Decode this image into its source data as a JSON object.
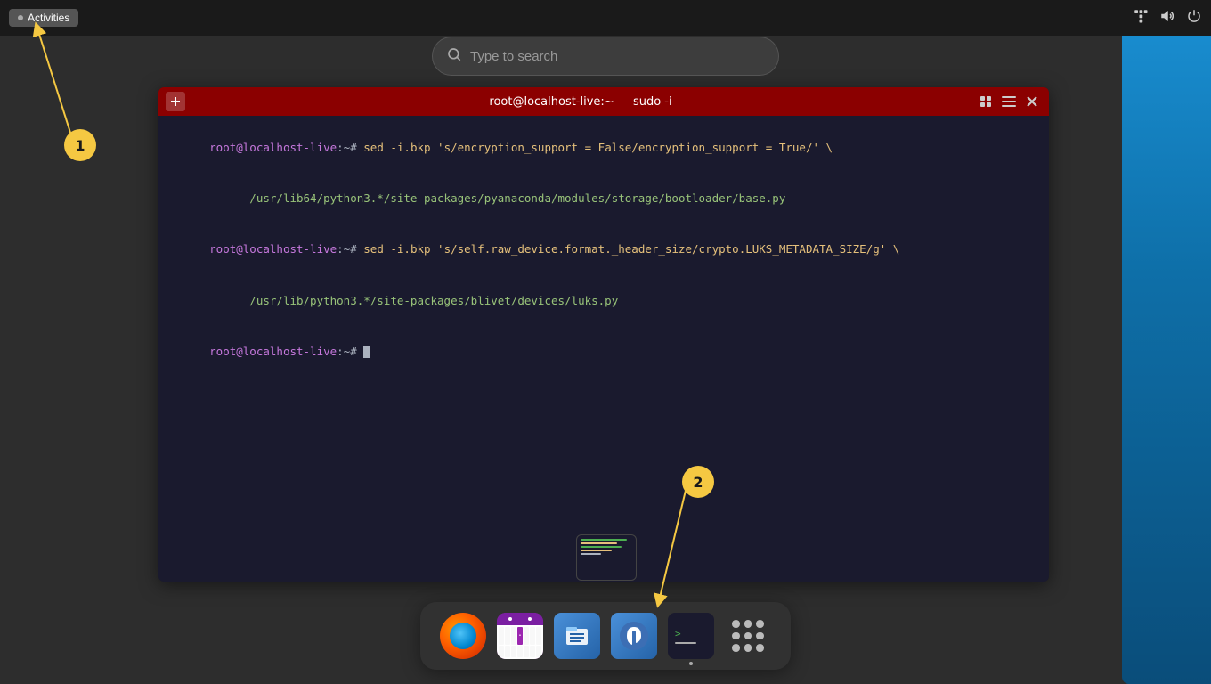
{
  "topbar": {
    "activities_label": "Activities",
    "icons": {
      "network": "⊞",
      "volume": "🔊",
      "power": "⏻"
    }
  },
  "search": {
    "placeholder": "Type to search"
  },
  "annotations": {
    "one": "1",
    "two": "2"
  },
  "terminal": {
    "title": "root@localhost-live:~ — sudo -i",
    "lines": [
      "root@localhost-live:~# sed -i.bkp 's/encryption_support = False/encryption_support = True/' \\",
      "     /usr/lib64/python3.*/site-packages/pyanaconda/modules/storage/bootloader/base.py",
      "root@localhost-live:~# sed -i.bkp 's/self.raw_device.format._header_size/crypto.LUKS_METADATA_SIZE/g' \\",
      "     /usr/lib/python3.*/site-packages/blivet/devices/luks.py",
      "root@localhost-live:~# "
    ]
  },
  "dock": {
    "items": [
      {
        "name": "Firefox",
        "id": "firefox"
      },
      {
        "name": "GNOME Calendar",
        "id": "calendar"
      },
      {
        "name": "Files",
        "id": "files"
      },
      {
        "name": "Fedora Media Writer",
        "id": "fedora"
      },
      {
        "name": "Terminal",
        "id": "terminal"
      },
      {
        "name": "App Grid",
        "id": "appgrid"
      }
    ]
  }
}
